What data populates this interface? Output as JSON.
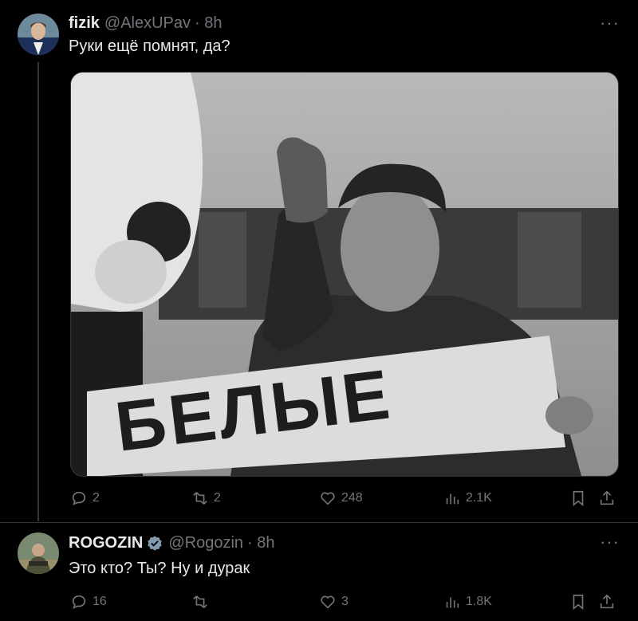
{
  "tweet1": {
    "display_name": "fizik",
    "handle": "@AlexUPav",
    "time": "· 8h",
    "text": "Руки ещё помнят, да?",
    "image_sign_text": "БЕЛЫЕ",
    "stats": {
      "replies": "2",
      "retweets": "2",
      "likes": "248",
      "views": "2.1K"
    }
  },
  "tweet2": {
    "display_name": "ROGOZIN",
    "handle": "@Rogozin",
    "time": "· 8h",
    "text": "Это кто? Ты? Ну и дурак",
    "stats": {
      "replies": "16",
      "retweets": "",
      "likes": "3",
      "views": "1.8K"
    }
  },
  "more_label": "···",
  "colors": {
    "background": "#000000",
    "text": "#e7e9ea",
    "muted": "#71767b",
    "verified": "#829aab"
  }
}
